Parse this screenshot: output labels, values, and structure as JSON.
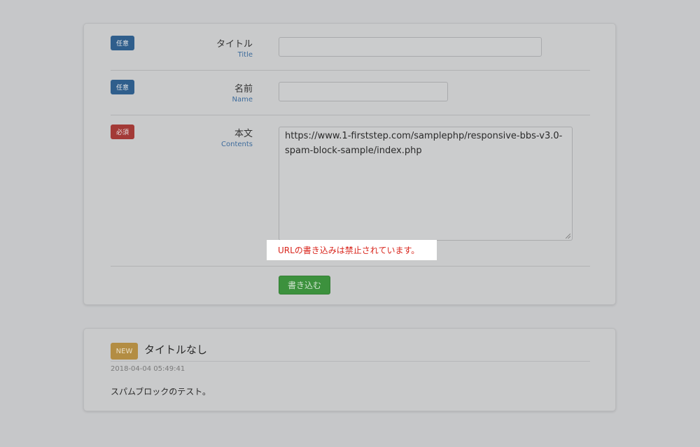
{
  "form": {
    "title_field": {
      "badge": "任意",
      "label": "タイトル",
      "label_en": "Title",
      "value": "",
      "placeholder": ""
    },
    "name_field": {
      "badge": "任意",
      "label": "名前",
      "label_en": "Name",
      "value": "",
      "placeholder": ""
    },
    "contents_field": {
      "badge": "必須",
      "label": "本文",
      "label_en": "Contents",
      "value": "https://www.1-firststep.com/samplephp/responsive-bbs-v3.0-spam-block-sample/index.php"
    },
    "error_message": "URLの書き込みは禁止されています。",
    "submit_label": "書き込む"
  },
  "posts": [
    {
      "badge": "NEW",
      "title": "タイトルなし",
      "date": "2018-04-04 05:49:41",
      "body": "スパムブロックのテスト。"
    }
  ],
  "colors": {
    "optional_badge": "#2f5e8c",
    "required_badge": "#a33a37",
    "submit_button": "#3c913d",
    "new_badge": "#b38d43",
    "error_text": "#d9251c"
  }
}
